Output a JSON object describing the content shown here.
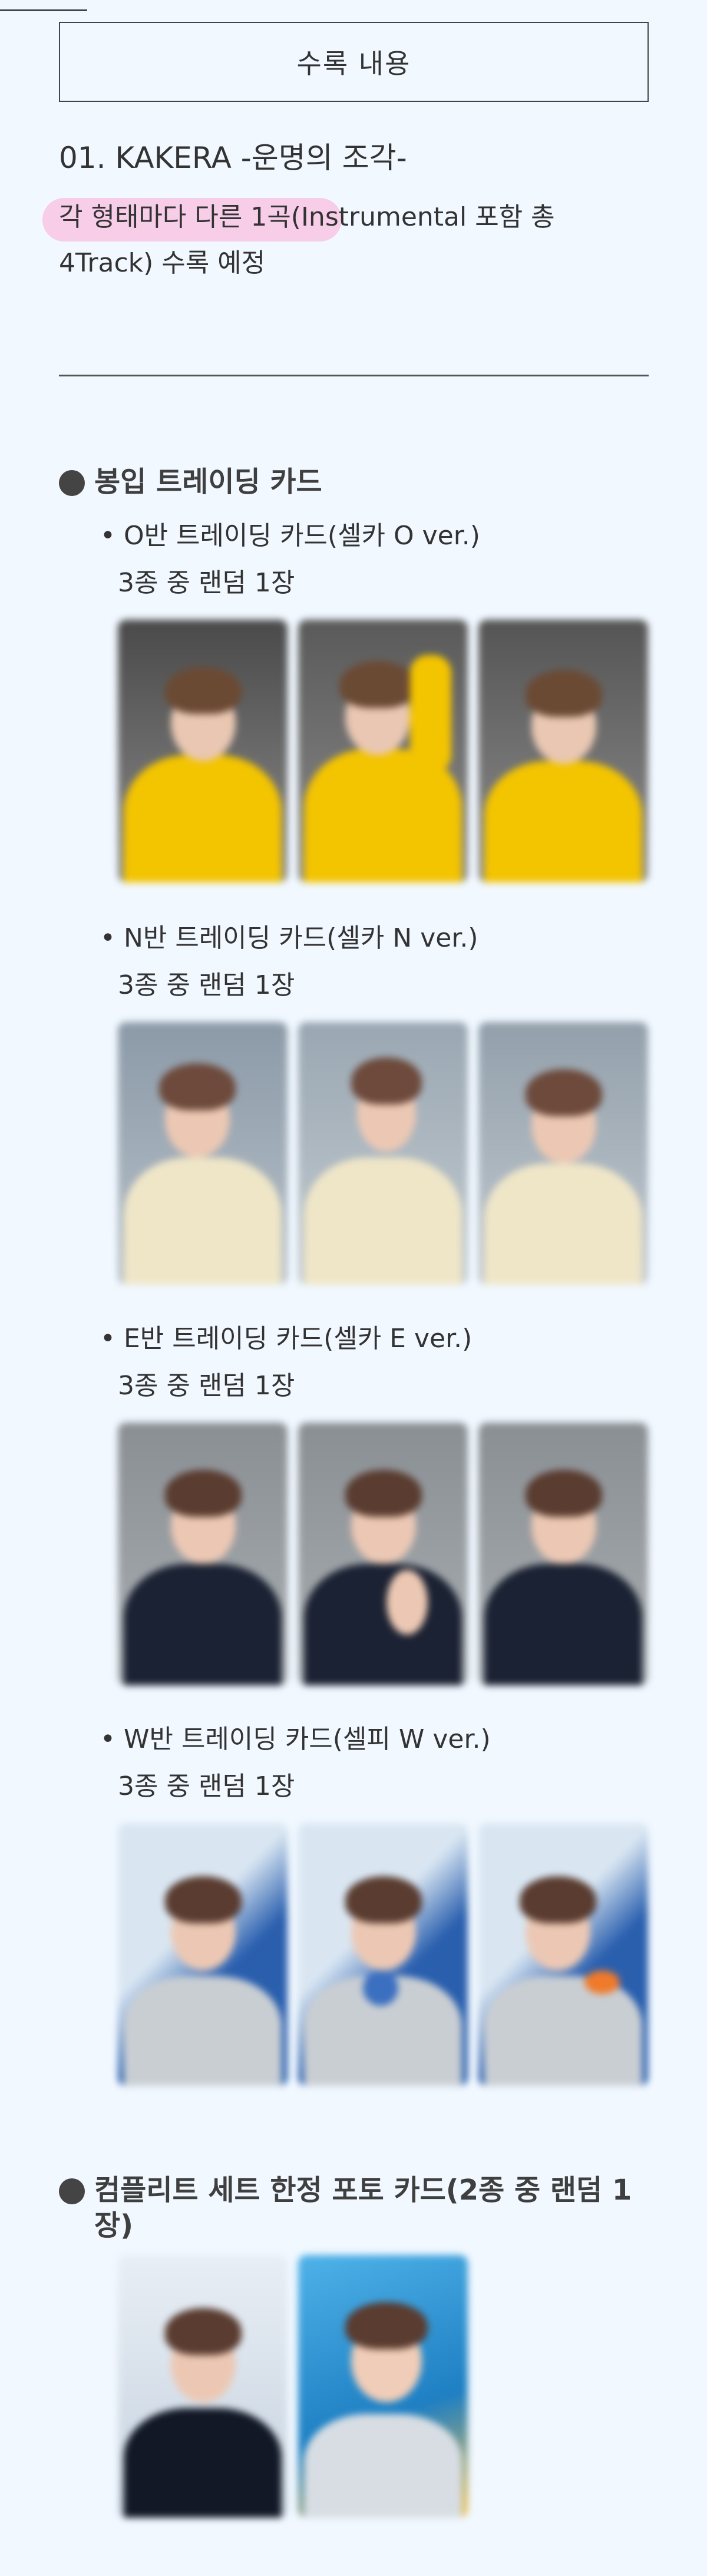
{
  "section": {
    "title": "수록 내용"
  },
  "track": {
    "title": "01. KAKERA -운명의 조각-",
    "description": "각 형태마다 다른 1곡(Instrumental 포함 총 4Track) 수록 예정"
  },
  "trading": {
    "heading": "봉입 트레이딩 카드",
    "cards": [
      {
        "label": "• O반 트레이딩 카드(셀카 O ver.)",
        "sub": "3종 중 랜덤 1장",
        "photo": "selfie-yellow-sweater"
      },
      {
        "label": "• N반 트레이딩 카드(셀카 N ver.)",
        "sub": "3종 중 랜덤 1장",
        "photo": "selfie-cream-jacket"
      },
      {
        "label": "• E반 트레이딩 카드(셀카 E ver.)",
        "sub": "3종 중 랜덤 1장",
        "photo": "selfie-navy-jacket"
      },
      {
        "label": "• W반 트레이딩 카드(셀피 W ver.)",
        "sub": "3종 중 랜덤 1장",
        "photo": "selfie-blue-background"
      }
    ]
  },
  "complete_set": {
    "heading": "컴플리트 세트 한정 포토 카드(2종 중 랜덤 1장)",
    "photos": [
      "photo-card-navy",
      "photo-card-blue"
    ]
  },
  "colors": {
    "page_bg": "#f1f8ff",
    "highlight": "#f8c6e4",
    "text": "#333333"
  }
}
